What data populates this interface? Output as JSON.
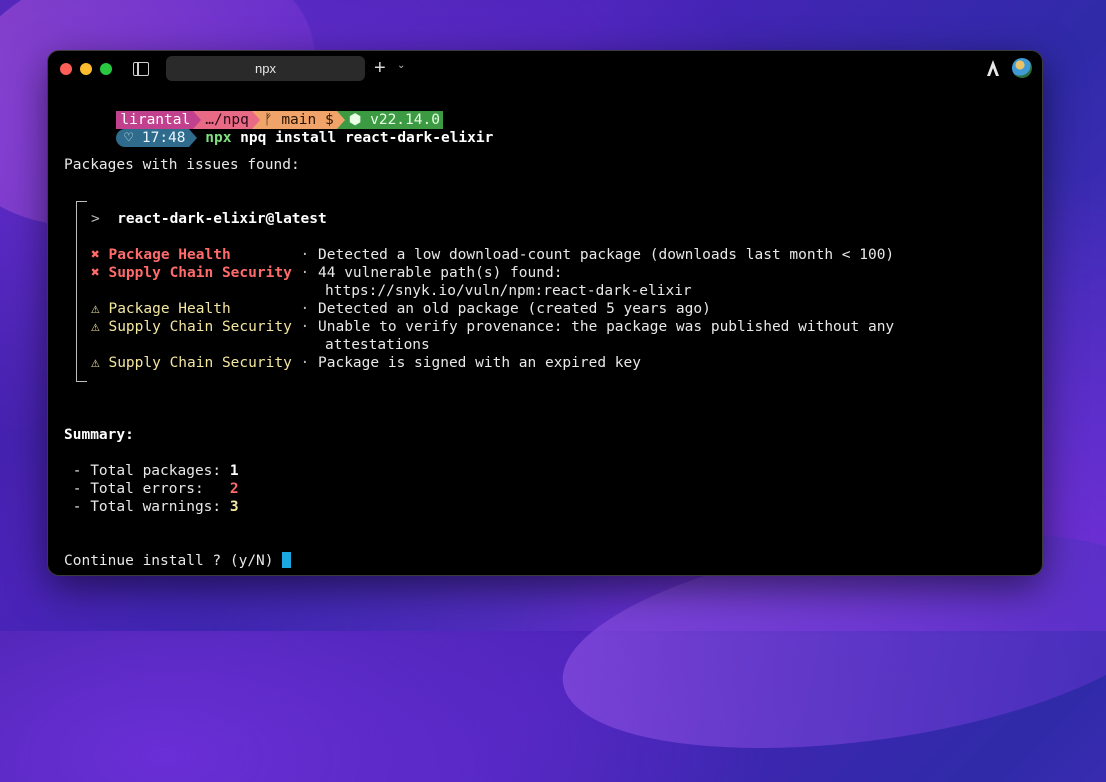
{
  "window": {
    "tab_title": "npx"
  },
  "prompt": {
    "user": "lirantal",
    "path": "…/npq",
    "git": "main $",
    "node": "v22.14.0",
    "time": "17:48",
    "command_bin": "npx",
    "command_rest": " npq install react-dark-elixir"
  },
  "output": {
    "issues_header": "Packages with issues found:",
    "package_name": "react-dark-elixir@latest",
    "issues": [
      {
        "icon": "✖",
        "category": "Package Health       ",
        "message": "Detected a low download-count package (downloads last month < 100)"
      },
      {
        "icon": "✖",
        "category": "Supply Chain Security",
        "message": "44 vulnerable path(s) found:",
        "message2": "https://snyk.io/vuln/npm:react-dark-elixir"
      },
      {
        "icon": "⚠",
        "category": "Package Health       ",
        "message": "Detected an old package (created 5 years ago)"
      },
      {
        "icon": "⚠",
        "category": "Supply Chain Security",
        "message": "Unable to verify provenance: the package was published without any",
        "message2": "attestations"
      },
      {
        "icon": "⚠",
        "category": "Supply Chain Security",
        "message": "Package is signed with an expired key"
      }
    ],
    "summary_title": "Summary:",
    "summary": {
      "packages_label": " - Total packages: ",
      "packages": "1",
      "errors_label": " - Total errors:   ",
      "errors": "2",
      "warnings_label": " - Total warnings: ",
      "warnings": "3"
    },
    "continue_prompt": "Continue install ? (y/N) "
  },
  "colors": {
    "error": "#ff6b6b",
    "warning": "#f4e7a0",
    "cursor": "#1ba7e0"
  }
}
